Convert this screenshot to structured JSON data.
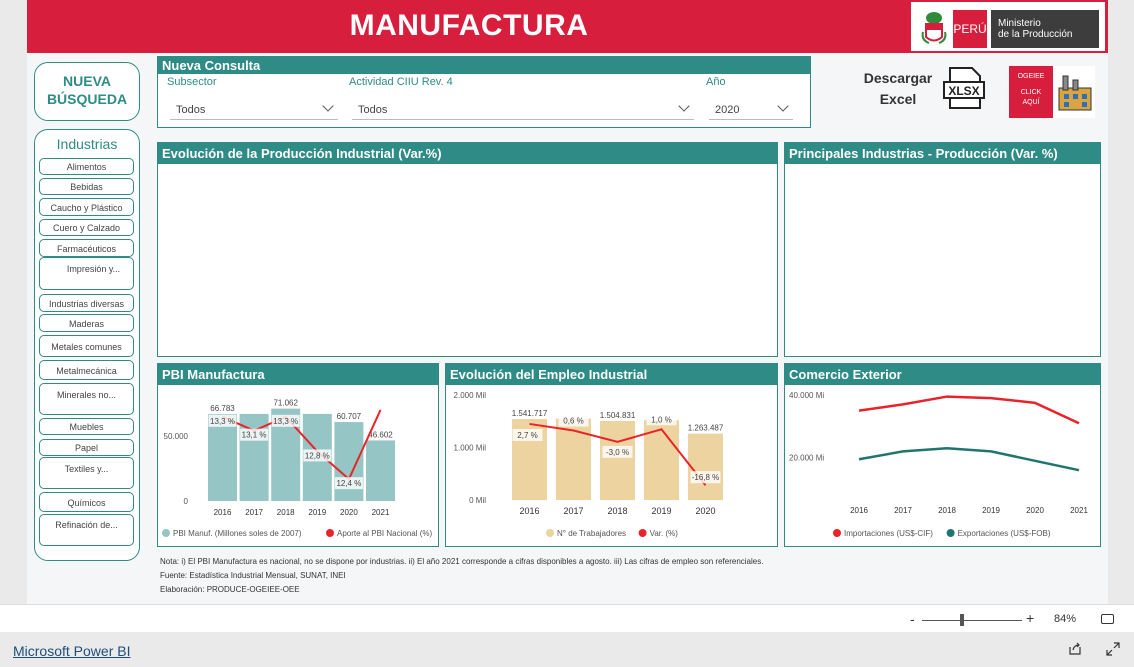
{
  "header": {
    "title": "MANUFACTURA",
    "logo_country": "PERÚ",
    "logo_ministry_line1": "Ministerio",
    "logo_ministry_line2": "de la Producción"
  },
  "sidebar": {
    "new_search_line1": "NUEVA",
    "new_search_line2": "BÚSQUEDA",
    "industries_title": "Industrias",
    "items": [
      "Alimentos",
      "Bebidas",
      "Caucho y Plástico",
      "Cuero y Calzado",
      "Farmacéuticos",
      "Impresión y...",
      "Industrias diversas",
      "Maderas",
      "Metales comunes",
      "Metalmecánica",
      "Minerales no...",
      "Muebles",
      "Papel",
      "Textiles y...",
      "Químicos",
      "Refinación de..."
    ]
  },
  "query": {
    "title": "Nueva Consulta",
    "subsector_label": "Subsector",
    "subsector_value": "Todos",
    "activity_label": "Actividad CIIU Rev. 4",
    "activity_value": "Todos",
    "year_label": "Año",
    "year_value": "2020"
  },
  "download": {
    "line1": "Descargar",
    "line2": "Excel",
    "xlsx_label": "XLSX",
    "ogeiee_line1": "OGEIEE",
    "ogeiee_line2": "CLICK",
    "ogeiee_line3": "AQUÍ"
  },
  "panels": {
    "evolution_title": "Evolución de la Producción Industrial (Var.%)",
    "top_industries_title": "Principales Industrias - Producción (Var. %)",
    "pbi_title": "PBI Manufactura",
    "employment_title": "Evolución del Empleo Industrial",
    "trade_title": "Comercio Exterior"
  },
  "chart_data": [
    {
      "type": "bar",
      "title": "PBI Manufactura",
      "categories": [
        "2016",
        "2017",
        "2018",
        "2019",
        "2020",
        "2021"
      ],
      "series": [
        {
          "name": "PBI Manuf. (Millones soles de 2007)",
          "values": [
            66783,
            67000,
            71062,
            67000,
            60707,
            46602
          ],
          "color": "#95c5c4"
        },
        {
          "name": "Aporte al PBI Nacional (%)",
          "values": [
            13.3,
            13.1,
            13.3,
            12.8,
            12.4,
            13.4
          ],
          "color": "#e8242a"
        }
      ],
      "bar_labels": [
        "66.783",
        "",
        "71.062",
        "",
        "60.707",
        "46.602"
      ],
      "line_labels": [
        "13,3 %",
        "13,1 %",
        "13,3 %",
        "12,8 %",
        "12,4 %",
        ""
      ],
      "yticks": [
        "50.000",
        "0"
      ],
      "ylim": [
        0,
        80000
      ]
    },
    {
      "type": "bar",
      "title": "Evolución del Empleo Industrial",
      "categories": [
        "2016",
        "2017",
        "2018",
        "2019",
        "2020"
      ],
      "series": [
        {
          "name": "N° de Trabajadores",
          "values": [
            1541717,
            1550000,
            1504831,
            1520000,
            1263487
          ],
          "color": "#ecd3a0"
        },
        {
          "name": "Var. (%)",
          "values": [
            2.7,
            0.6,
            -3.0,
            1.0,
            -16.8
          ],
          "color": "#e8242a"
        }
      ],
      "bar_labels": [
        "1.541.717",
        "",
        "1.504.831",
        "",
        "1.263.487"
      ],
      "line_labels": [
        "2,7 %",
        "0,6 %",
        "-3,0 %",
        "1,0 %",
        "-16,8 %"
      ],
      "yticks": [
        "2.000 Mil",
        "1.000 Mil",
        "0 Mil"
      ],
      "ylim": [
        0,
        2000000
      ]
    },
    {
      "type": "line",
      "title": "Comercio Exterior",
      "categories": [
        "2016",
        "2017",
        "2018",
        "2019",
        "2020",
        "2021"
      ],
      "series": [
        {
          "name": "Importaciones (US$-CIF)",
          "values": [
            35000,
            37000,
            39500,
            39000,
            37500,
            31000
          ],
          "color": "#e8242a"
        },
        {
          "name": "Exportaciones (US$-FOB)",
          "values": [
            19500,
            22000,
            23000,
            22000,
            19000,
            16000
          ],
          "color": "#20756f"
        }
      ],
      "yticks": [
        "40.000 Mi",
        "20.000 Mi"
      ],
      "ylim": [
        10000,
        40000
      ]
    }
  ],
  "notes": {
    "line1": "Nota: i) El PBI Manufactura es nacional, no se dispone por industrias. ii) El año 2021 corresponde a cifras disponibles a agosto. iii) Las cifras de empleo son referenciales.",
    "line2": "Fuente: Estadística Industrial Mensual, SUNAT, INEI",
    "line3": "Elaboración: PRODUCE-OGEIEE-OEE"
  },
  "status": {
    "zoom_minus": "-",
    "zoom_plus": "+",
    "zoom_level": "84%"
  },
  "footer": {
    "powerbi_link": "Microsoft Power BI"
  },
  "colors": {
    "teal": "#2e8b86",
    "red": "#d71e3d"
  }
}
